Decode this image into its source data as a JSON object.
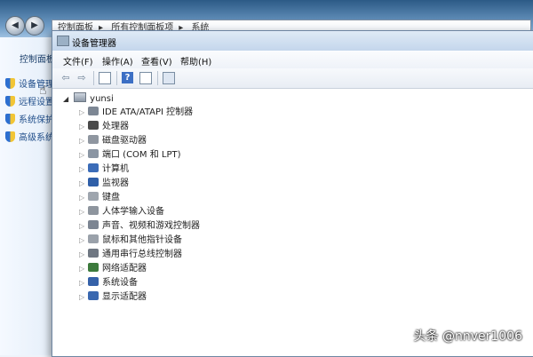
{
  "background_window": {
    "address_parts": [
      "控制面板",
      "所有控制面板项",
      "系统"
    ],
    "sidebar_title": "控制面板",
    "links": [
      "设备管理",
      "远程设置",
      "系统保护",
      "高级系统"
    ]
  },
  "device_manager": {
    "title": "设备管理器",
    "menu": [
      "文件(F)",
      "操作(A)",
      "查看(V)",
      "帮助(H)"
    ],
    "tree": {
      "root": "yunsi",
      "items": [
        {
          "label": "IDE ATA/ATAPI 控制器",
          "icon": "ide-controller-icon",
          "color": "#7d8794"
        },
        {
          "label": "处理器",
          "icon": "processor-icon",
          "color": "#4a4a4a"
        },
        {
          "label": "磁盘驱动器",
          "icon": "disk-drive-icon",
          "color": "#8f96a0"
        },
        {
          "label": "端口 (COM 和 LPT)",
          "icon": "port-icon",
          "color": "#8a95a3"
        },
        {
          "label": "计算机",
          "icon": "computer-icon",
          "color": "#3b6cb8"
        },
        {
          "label": "监视器",
          "icon": "monitor-icon",
          "color": "#2f5fa8"
        },
        {
          "label": "键盘",
          "icon": "keyboard-icon",
          "color": "#9ea5ae"
        },
        {
          "label": "人体学输入设备",
          "icon": "hid-icon",
          "color": "#8e959e"
        },
        {
          "label": "声音、视频和游戏控制器",
          "icon": "sound-icon",
          "color": "#7c8592"
        },
        {
          "label": "鼠标和其他指针设备",
          "icon": "mouse-icon",
          "color": "#9aa1aa"
        },
        {
          "label": "通用串行总线控制器",
          "icon": "usb-icon",
          "color": "#6f7782"
        },
        {
          "label": "网络适配器",
          "icon": "network-adapter-icon",
          "color": "#3c7a3c"
        },
        {
          "label": "系统设备",
          "icon": "system-device-icon",
          "color": "#3561a8"
        },
        {
          "label": "显示适配器",
          "icon": "display-adapter-icon",
          "color": "#3a68b0"
        }
      ]
    }
  },
  "watermark": "头条 @nnver1006"
}
